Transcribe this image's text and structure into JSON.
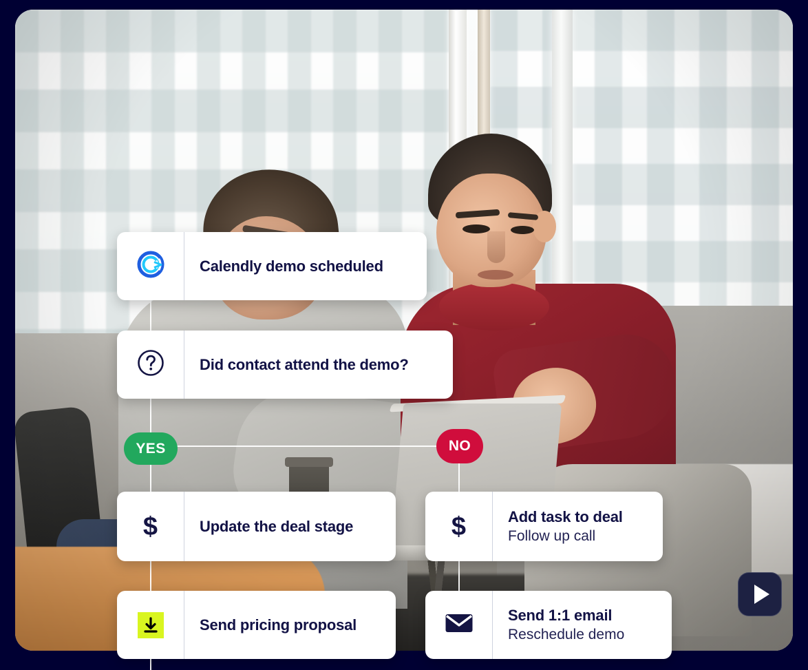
{
  "page": {
    "background_color": "#000033",
    "accent_navy": "#121245"
  },
  "media": {
    "scene_description": "Two businessmen seated by an office window with a laptop",
    "play_button_label": "▶",
    "play_button_name": "play-video-button"
  },
  "workflow": {
    "title": "Calendly demo scheduled workflow",
    "nodes": [
      {
        "id": "calendly",
        "icon": "calendly-logo-icon",
        "title": "Calendly demo scheduled",
        "subtitle": ""
      },
      {
        "id": "question",
        "icon": "question-mark-circle-icon",
        "title": "Did contact attend the demo?",
        "subtitle": ""
      },
      {
        "id": "update-deal",
        "icon": "dollar-sign-icon",
        "title": "Update the deal stage",
        "subtitle": ""
      },
      {
        "id": "add-task",
        "icon": "dollar-sign-icon",
        "title": "Add task to deal",
        "subtitle": "Follow up call"
      },
      {
        "id": "pricing",
        "icon": "download-document-icon",
        "title": "Send pricing proposal",
        "subtitle": ""
      },
      {
        "id": "email",
        "icon": "envelope-icon",
        "title": "Send 1:1 email",
        "subtitle": "Reschedule demo"
      }
    ],
    "branches": [
      {
        "id": "yes",
        "label": "YES",
        "color": "#22a85d"
      },
      {
        "id": "no",
        "label": "NO",
        "color": "#d00d3c"
      }
    ]
  }
}
